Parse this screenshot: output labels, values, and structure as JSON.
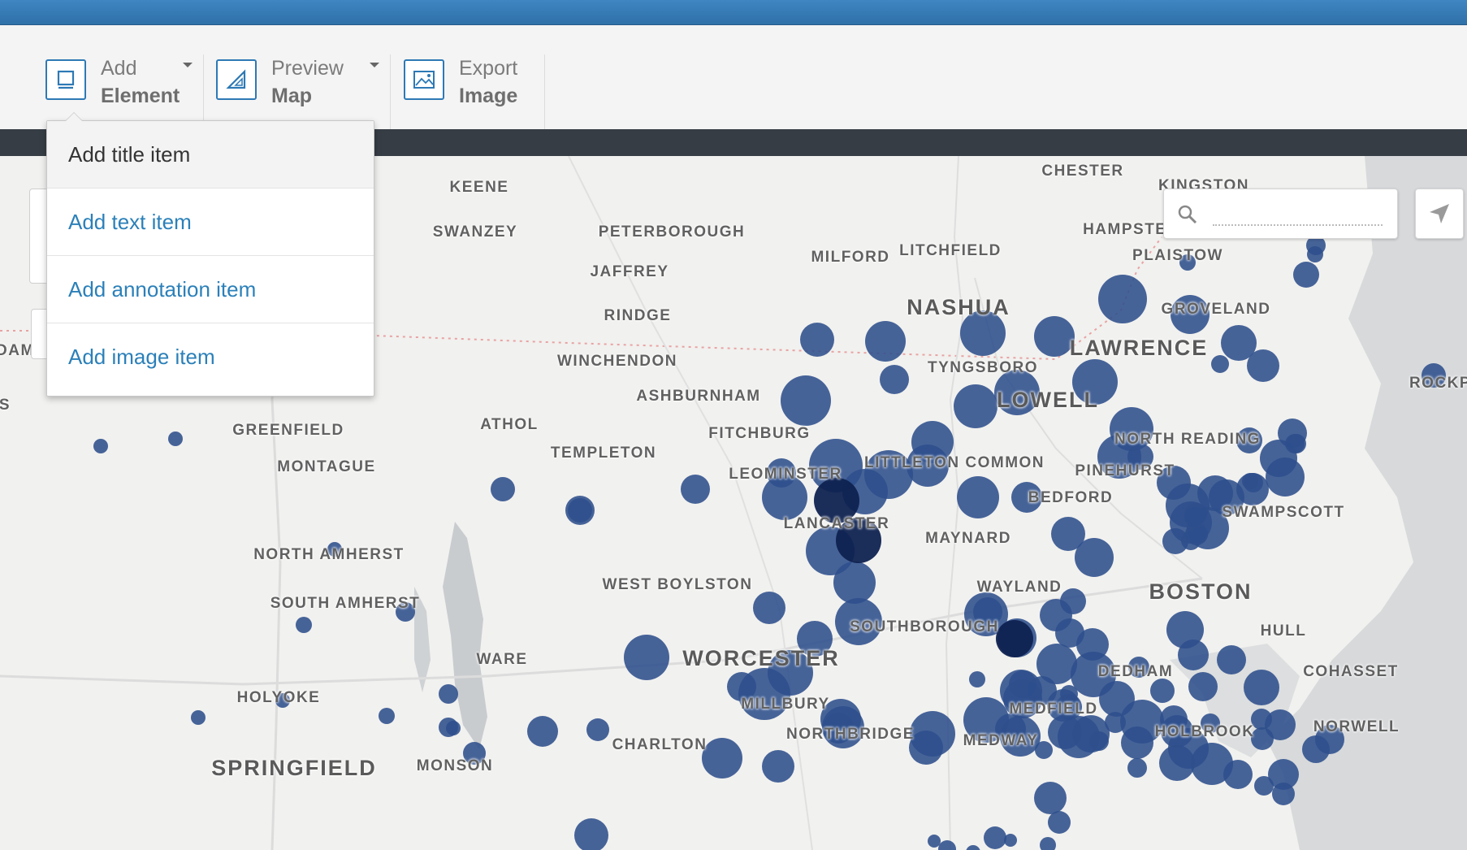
{
  "toolbar": {
    "add_element": {
      "line1": "Add",
      "line2": "Element"
    },
    "preview_map": {
      "line1": "Preview",
      "line2": "Map"
    },
    "export_image": {
      "line1": "Export",
      "line2": "Image"
    }
  },
  "dropdown": {
    "items": [
      "Add title item",
      "Add text item",
      "Add annotation item",
      "Add image item"
    ]
  },
  "search": {
    "placeholder": ""
  },
  "icons": {
    "add_element": "square-frame-icon",
    "preview_map": "ruler-triangle-icon",
    "export_image": "image-icon",
    "search": "magnifier-icon",
    "locate": "location-arrow-icon"
  },
  "colors": {
    "topbar": "#3577b0",
    "accent": "#2b80b9",
    "marker": "#2e4f8c",
    "marker_dark": "#0f2250"
  },
  "map": {
    "towns": [
      "KEENE",
      "SWANZEY",
      "PETERBOROUGH",
      "JAFFREY",
      "RINDGE",
      "MILFORD",
      "LITCHFIELD",
      "CHESTER",
      "KINGSTON",
      "HAMPSTEAD",
      "PLAISTOW",
      "GROVELAND",
      "TYNGSBORO",
      "WINCHENDON",
      "ASHBURNHAM",
      "GREENFIELD",
      "ATHOL",
      "FITCHBURG",
      "TEMPLETON",
      "MONTAGUE",
      "LEOMINSTER",
      "LITTLETON COMMON",
      "NORTH READING",
      "PINEHURST",
      "BEDFORD",
      "SWAMPSCOTT",
      "LANCASTER",
      "MAYNARD",
      "NORTH AMHERST",
      "SOUTH AMHERST",
      "WEST BOYLSTON",
      "WAYLAND",
      "HULL",
      "SOUTHBOROUGH",
      "WARE",
      "DEDHAM",
      "COHASSET",
      "HOLYOKE",
      "MILLBURY",
      "MEDFIELD",
      "NORTHBRIDGE",
      "MEDWAY",
      "HOLBROOK",
      "NORWELL",
      "CHARLTON",
      "MONSON",
      "DAMS",
      "ROCKP",
      "S"
    ],
    "cities": [
      "NASHUA",
      "LAWRENCE",
      "LOWELL",
      "BOSTON",
      "WORCESTER",
      "SPRINGFIELD"
    ]
  }
}
